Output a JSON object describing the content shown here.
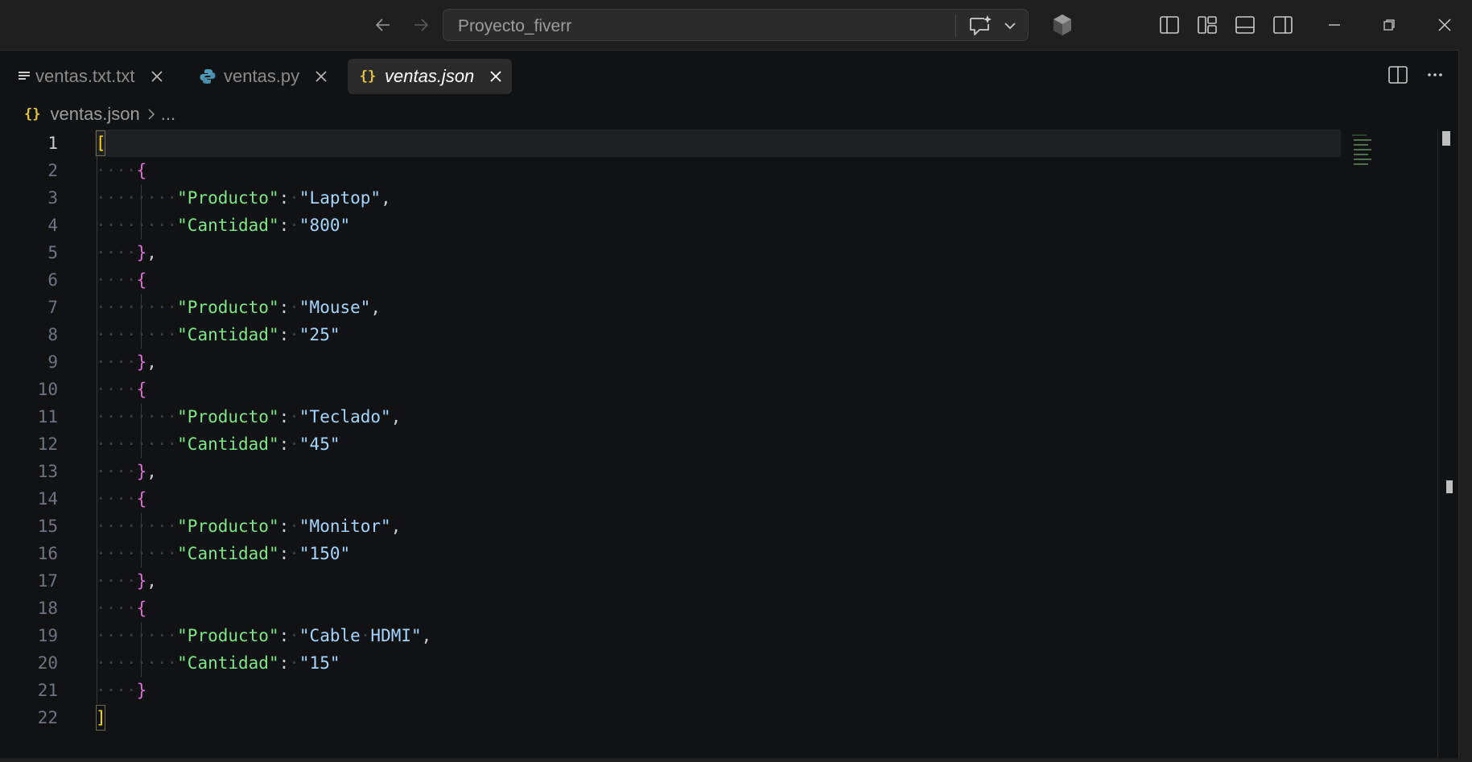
{
  "titlebar": {
    "search_text": "Proyecto_fiverr",
    "icons": [
      "back-arrow-icon",
      "forward-arrow-icon",
      "chat-sparkle-icon",
      "chevron-down-icon",
      "copilot-icon",
      "toggle-primary-sidebar-icon",
      "customize-layout-icon",
      "toggle-panel-icon",
      "toggle-secondary-sidebar-icon",
      "minimize-icon",
      "restore-icon",
      "close-icon"
    ]
  },
  "tabs": [
    {
      "label": "ventas.txt.txt",
      "icon": "text-file-icon",
      "active": false
    },
    {
      "label": "ventas.py",
      "icon": "python-icon",
      "active": false
    },
    {
      "label": "ventas.json",
      "icon": "json-icon",
      "active": true
    }
  ],
  "breadcrumb": {
    "file": "ventas.json",
    "more": "..."
  },
  "colors": {
    "background": "#111214",
    "json_key": "#7ee787",
    "json_string": "#a5d6ff",
    "bracket_level1": "#ffd700",
    "bracket_level2": "#da70d6"
  },
  "editor": {
    "current_line": 1,
    "lines": [
      {
        "n": "1",
        "text": "["
      },
      {
        "n": "2",
        "text": "    {"
      },
      {
        "n": "3",
        "text": "        \"Producto\": \"Laptop\","
      },
      {
        "n": "4",
        "text": "        \"Cantidad\": \"800\""
      },
      {
        "n": "5",
        "text": "    },"
      },
      {
        "n": "6",
        "text": "    {"
      },
      {
        "n": "7",
        "text": "        \"Producto\": \"Mouse\","
      },
      {
        "n": "8",
        "text": "        \"Cantidad\": \"25\""
      },
      {
        "n": "9",
        "text": "    },"
      },
      {
        "n": "10",
        "text": "    {"
      },
      {
        "n": "11",
        "text": "        \"Producto\": \"Teclado\","
      },
      {
        "n": "12",
        "text": "        \"Cantidad\": \"45\""
      },
      {
        "n": "13",
        "text": "    },"
      },
      {
        "n": "14",
        "text": "    {"
      },
      {
        "n": "15",
        "text": "        \"Producto\": \"Monitor\","
      },
      {
        "n": "16",
        "text": "        \"Cantidad\": \"150\""
      },
      {
        "n": "17",
        "text": "    },"
      },
      {
        "n": "18",
        "text": "    {"
      },
      {
        "n": "19",
        "text": "        \"Producto\": \"Cable HDMI\","
      },
      {
        "n": "20",
        "text": "        \"Cantidad\": \"15\""
      },
      {
        "n": "21",
        "text": "    }"
      },
      {
        "n": "22",
        "text": "]"
      }
    ]
  }
}
